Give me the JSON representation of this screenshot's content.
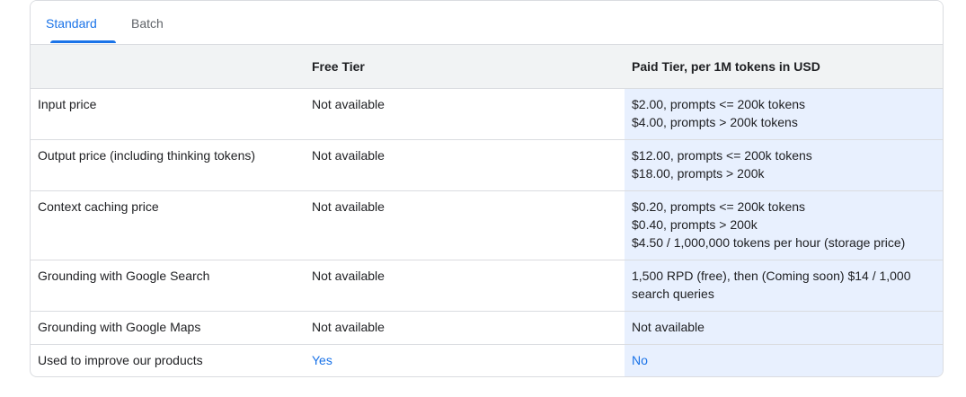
{
  "tabs": [
    {
      "label": "Standard",
      "active": true
    },
    {
      "label": "Batch",
      "active": false
    }
  ],
  "table": {
    "headers": [
      "",
      "Free Tier",
      "Paid Tier, per 1M tokens in USD"
    ],
    "rows": [
      {
        "label": "Input price",
        "free": "Not available",
        "paid": [
          "$2.00, prompts <= 200k tokens",
          "$4.00, prompts > 200k tokens"
        ]
      },
      {
        "label": "Output price (including thinking tokens)",
        "free": "Not available",
        "paid": [
          "$12.00, prompts <= 200k tokens",
          "$18.00, prompts > 200k"
        ]
      },
      {
        "label": "Context caching price",
        "free": "Not available",
        "paid": [
          "$0.20, prompts <= 200k tokens",
          "$0.40, prompts > 200k",
          "$4.50 / 1,000,000 tokens per hour (storage price)"
        ]
      },
      {
        "label": "Grounding with Google Search",
        "free": "Not available",
        "paid": [
          "1,500 RPD (free), then (Coming soon) $14 / 1,000",
          "search queries"
        ]
      },
      {
        "label": "Grounding with Google Maps",
        "free": "Not available",
        "paid": [
          "Not available"
        ]
      },
      {
        "label": "Used to improve our products",
        "free": "Yes",
        "paid": [
          "No"
        ]
      }
    ]
  },
  "colors": {
    "accent": "#1a73e8",
    "header_bg": "#f1f3f4",
    "paid_column_bg": "#e8f0fe",
    "border": "#dadce0"
  }
}
